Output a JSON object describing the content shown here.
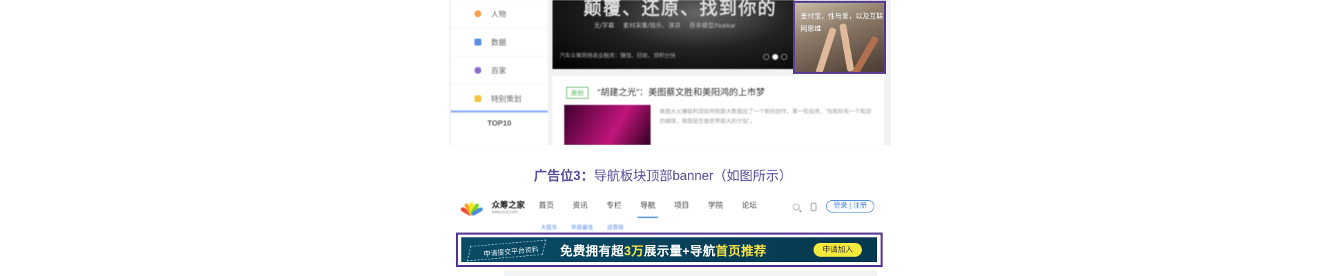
{
  "top_screenshot": {
    "sidebar": {
      "items": [
        {
          "label": "人物",
          "color": "#f5a04a"
        },
        {
          "label": "数据",
          "color": "#5b8ee6"
        },
        {
          "label": "百家",
          "color": "#8a6fd1"
        },
        {
          "label": "特别策划",
          "color": "#f3c241"
        }
      ],
      "top10_label": "TOP10"
    },
    "hero": {
      "title": "颠覆、还原、找到你的",
      "subtitle": "无/字幕   素材采集/独乐、演讲   原来模型/Nukkar",
      "footer": "汽车众筹网络商业融资：赚钱、回收、领积分快"
    },
    "ad_box": {
      "text": "支付宝，性与爱，以及互联网思维"
    },
    "article": {
      "tag": "原创",
      "title": "“胡建之光”：美图蔡文胜和美阳鸿的上市梦",
      "description": "美图大火赚取利润如何抢跑大数据出了一个新的创作，第一轮投资，“你和你有一个和旧的媒体，美图是在做世界级大的计划”。"
    }
  },
  "caption": {
    "strong": "广告位3：",
    "text": "导航板块顶部banner（如图所示）"
  },
  "bottom_screenshot": {
    "logo": {
      "name": "众筹之家",
      "url": "www.zczj.com"
    },
    "nav": [
      "首页",
      "资讯",
      "专栏",
      "导航",
      "项目",
      "学院",
      "论坛"
    ],
    "active_nav": "导航",
    "login_label": "登录 | 注册",
    "subnav": [
      "大股东",
      "年度最佳",
      "运营商"
    ],
    "banner": {
      "apply_text": "申请提交平台资料",
      "slogan_pre": "免费拥有超",
      "slogan_hl1": "3万",
      "slogan_mid": "展示量+导航",
      "slogan_hl2": "首页推荐",
      "button": "申请加入",
      "bg_color": "#0a4c66",
      "highlight_color": "#f8e243"
    }
  },
  "colors": {
    "frame": "#5a3c96",
    "caption": "#5a4e9a",
    "accent_blue": "#4a8de0"
  }
}
